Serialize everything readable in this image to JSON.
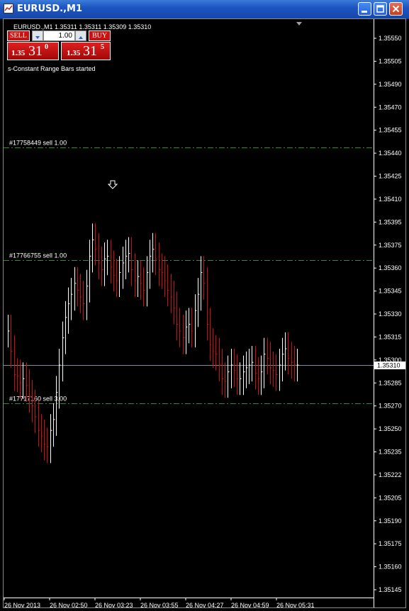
{
  "window": {
    "title": "EURUSD.,M1",
    "minimize_icon": "minimize-icon",
    "maximize_icon": "maximize-icon",
    "close_icon": "close-icon"
  },
  "chart_header": {
    "symbol_line": "EURUSD.,M1  1.35311 1.35311 1.35309 1.35310"
  },
  "trade_panel": {
    "sell_label": "SELL",
    "buy_label": "BUY",
    "lot_value": "1.00",
    "sell_price_prefix": "1.35",
    "sell_price_big": "31",
    "sell_price_sup": "0",
    "buy_price_prefix": "1.35",
    "buy_price_big": "31",
    "buy_price_sup": "5"
  },
  "status_text": "s-Constant Range Bars started",
  "orders": [
    {
      "label": "#17758449 sell 1.00",
      "price": 1.3547
    },
    {
      "label": "#17766755 sell 1.00",
      "price": 1.35387
    },
    {
      "label": "#17717160 sell 3.00",
      "price": 1.35282
    }
  ],
  "current_price": "1.35310",
  "colors": {
    "background": "#000000",
    "axis_text": "#ffffff",
    "bar_up": "#ffffff",
    "bar_down": "#d01010",
    "order_line": "#2f8f2f",
    "bid_line": "#7a8aa8",
    "sell_button": "#cc1111"
  },
  "chart_data": {
    "type": "line",
    "price_axis": {
      "min": 1.35145,
      "max": 1.3555,
      "ticks": [
        "1.35550",
        "1.35505",
        "1.35490",
        "1.35470",
        "1.35455",
        "1.35440",
        "1.35425",
        "1.35410",
        "1.35395",
        "1.35375",
        "1.35360",
        "1.35345",
        "1.35330",
        "1.35315",
        "1.35300",
        "1.35285",
        "1.35270",
        "1.35250",
        "1.35235",
        "1.35222",
        "1.35205",
        "1.35190",
        "1.35175",
        "1.35160",
        "1.35145"
      ]
    },
    "time_labels": [
      "26 Nov 2013",
      "26 Nov 02:50",
      "26 Nov 03:23",
      "26 Nov 03:55",
      "26 Nov 04:27",
      "26 Nov 04:59",
      "26 Nov 05:31"
    ],
    "series": [
      {
        "values": [
          1.35335,
          1.3532,
          1.35303,
          1.35302,
          1.35297,
          1.353,
          1.35295,
          1.35287,
          1.3528,
          1.35272,
          1.35262,
          1.35258,
          1.35252,
          1.3525,
          1.35262,
          1.3527,
          1.3529,
          1.3531,
          1.3533,
          1.35345,
          1.35355,
          1.35362,
          1.3537,
          1.35365,
          1.3536,
          1.35355,
          1.35368,
          1.3539,
          1.35402,
          1.35395,
          1.35385,
          1.3538,
          1.35388,
          1.3539,
          1.35382,
          1.35376,
          1.35372,
          1.35378,
          1.35385,
          1.3539,
          1.35392,
          1.3538,
          1.35372,
          1.35375,
          1.3537,
          1.35365,
          1.35378,
          1.3539,
          1.35395,
          1.35388,
          1.3538,
          1.35378,
          1.35372,
          1.35365,
          1.3536,
          1.35352,
          1.3534,
          1.35335,
          1.3533,
          1.35338,
          1.3534,
          1.35335,
          1.3535,
          1.35362,
          1.35378,
          1.3537,
          1.3534,
          1.35325,
          1.3532,
          1.35318,
          1.3531,
          1.353,
          1.35298,
          1.35305,
          1.3531,
          1.35306,
          1.353,
          1.353,
          1.35305,
          1.35308,
          1.3531,
          1.35312,
          1.35304,
          1.353,
          1.35305,
          1.35318,
          1.35315,
          1.35308,
          1.35306,
          1.35303,
          1.3531,
          1.35318,
          1.35322,
          1.35315,
          1.35312,
          1.3531,
          1.3531
        ]
      }
    ]
  }
}
